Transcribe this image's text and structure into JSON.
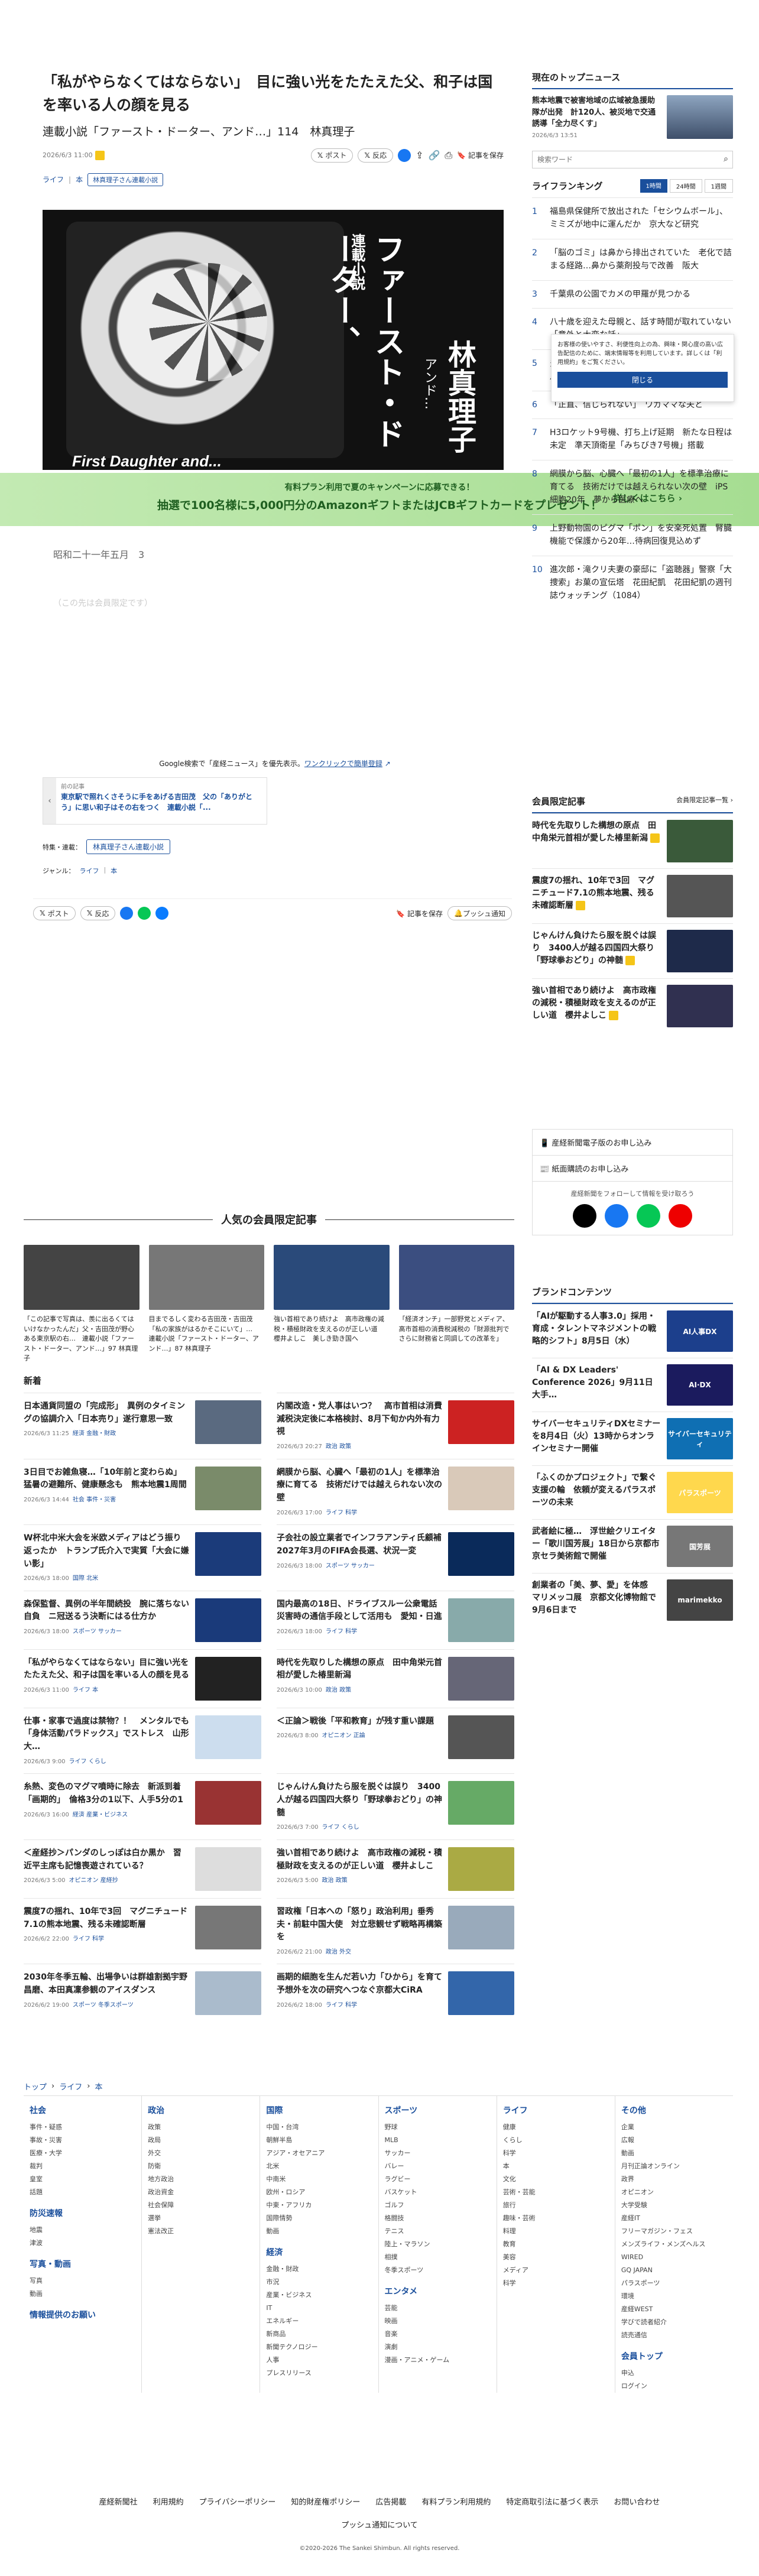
{
  "article": {
    "title": "「私がやらなくてはならない」　目に強い光をたたえた父、和子は国を率いる人の顔を見る",
    "subtitle": "連載小説「ファースト・ドーター、アンド…」114　林真理子",
    "date": "2026/6/3 11:00",
    "category_links": [
      "ライフ",
      "本"
    ],
    "series_tag": "林真理子さん連載小説",
    "share_labels": [
      "ポスト",
      "反応"
    ],
    "save_label": "記事を保存",
    "hero": {
      "series": "連載小説",
      "title_vertical": "ファースト・ドーター、",
      "title_and": "アンド…",
      "author_vertical": "林真理子",
      "english": "First Daughter and..."
    },
    "body_date": "昭和二十一年五月　3",
    "body_faded": "（この先は会員限定です）",
    "google_pref_text": "Google検索で「産経ニュース」を優先表示。",
    "google_pref_link": "ワンクリックで簡単登録",
    "prev_label": "前の記事",
    "prev_text": "東京駅で照れくさそうに手をあげる吉田茂　父の「ありがとう」に思い和子はその右をつく　連載小説「...",
    "feature_label": "特集・連載：",
    "feature_tag": "林真理子さん連載小説",
    "genre_label": "ジャンル：",
    "genre_values": [
      "ライフ",
      "本"
    ],
    "bottom_save_label": "記事を保存",
    "push_label": "プッシュ通知"
  },
  "promo": {
    "line1": "有料プラン利用で夏のキャンペーンに応募できる！",
    "line2": "抽選で100名様に5,000円分のAmazonギフトまたはJCBギフトカードをプレゼント！",
    "more": "詳しくはこちら"
  },
  "sidebar": {
    "top_news_title": "現在のトップニュース",
    "top_news_text": "熊本地震で被害地域の広域被急援助隊が出発　計120人、被災地で交通誘導「全力尽くす」",
    "top_news_date": "2026/6/3 13:51",
    "search_placeholder": "検索ワード",
    "ranking_title": "ライフランキング",
    "ranking_tabs": [
      "1時間",
      "24時間",
      "1週間"
    ],
    "ranking_items": [
      {
        "num": "1",
        "text": "福島県保健所で放出された「セシウムボール」、ミミズが地中に運んだか　京大など研究"
      },
      {
        "num": "2",
        "text": "「脳のゴミ」は鼻から排出されていた　老化で詰まる経路…鼻から薬剤投与で改善　阪大"
      },
      {
        "num": "3",
        "text": "千葉県の公園でカメの甲羅が見つかる"
      },
      {
        "num": "4",
        "text": "八十歳を迎えた母親と、話す時間が取れていない　「意外と大変な話」"
      },
      {
        "num": "5",
        "text": "多摩動物園でライオン3頭死亡、雨で影響か　7月から10頭体制　ライオン展示"
      },
      {
        "num": "6",
        "text": "「正直、信じられない」　ワガママな夫と"
      },
      {
        "num": "7",
        "text": "H3ロケット9号機、打ち上げ延期　新たな日程は未定　準天頂衛星「みちびき7号機」搭載"
      },
      {
        "num": "8",
        "text": "網膜から脳、心臓へ「最初の1人」を標準治療に育てる　技術だけでは越えられない次の壁　iPS細胞20年　夢から医療へ"
      },
      {
        "num": "9",
        "text": "上野動物園のピグマ「ポン」を安楽死処置　腎臓機能で保護から20年…待病回復見込めず"
      },
      {
        "num": "10",
        "text": "進次郎・滝クリ夫妻の豪邸に「盗聴器」警察「大捜索」お菓の宣伝塔　花田紀凱　花田紀凱の週刊誌ウォッチング（1084）"
      }
    ],
    "cookie": {
      "text": "お客様の使いやすさ、利便性向上の為、興味・関心度の高い広告配信のために、端末情報等を利用しています。詳しくは「利用規約」をご覧ください。",
      "link": "利用規約",
      "close": "閉じる"
    },
    "member_title": "会員限定記事",
    "member_more": "会員限定記事一覧",
    "member_items": [
      "時代を先取りした構想の原点　田中角栄元首相が愛した椿里新潟",
      "震度7の揺れ、10年で3回　マグニチュード7.1の熊本地震、残る未確認断層",
      "じゃんけん負けたら服を脱ぐは誤り　3400人が越る四国四大祭り「野球拳おどり」の神髄",
      "強い首相であり続けよ　高市政権の減税・積極財政を支えるのが正しい道　櫻井よしこ"
    ],
    "newsletter_label": "産経新聞電子版のお申し込み",
    "paper_label": "紙面購読のお申し込み",
    "follow_label": "産経新聞をフォローして情報を受け取ろう",
    "brand_title": "ブランドコンテンツ",
    "brand_items": [
      "「AIが駆動する人事3.0」採用・育成・タレントマネジメントの戦略的シフト」8月5日（水）",
      "「AI & DX Leaders' Conference 2026」9月11日大手…",
      "サイバーセキュリティDXセミナーを8月4日（火）13時からオンラインセミナー開催",
      "「ふくのかプロジェクト」で繋ぐ支援の輪　依頼が変えるパラスポーツの未来",
      "武者絵に極…　浮世絵クリエイター「歌川国芳展」18日から京都市京セラ美術館で開催",
      "創業者の「美、夢、愛」を体感　マリメッコ展　京都文化博物館で9月6日まで"
    ],
    "brand_thumbs": [
      "AI人事DX",
      "AI·DX",
      "サイバーセキュリティ",
      "パラスポーツ",
      "国芳展",
      "marimekko"
    ]
  },
  "popular": {
    "title": "人気の会員限定記事",
    "items": [
      {
        "text": "「この記事で写真は、羨に出るくてはいけなかったんだ」父・吉田茂が野心ある東京駅の右…　連載小説「ファースト・ドーター、アンド…」97 林真理子"
      },
      {
        "text": "目までるしく変わる吉田茂・吉田茂「私の家族がはるかそこにいて」…　連載小説「ファースト・ドーター、アンド…」87 林真理子"
      },
      {
        "text": "強い首相であり続けよ　高市政権の減税・積極財政を支えるのが正しい道　櫻井よしこ　美しき勁き国へ"
      },
      {
        "text": "「経済オンチ」一部野党とメディア、高市首相の消費税減税の「財源批判でさらに財務省と同調しての改革を」"
      }
    ]
  },
  "news": {
    "title": "新着",
    "items": [
      {
        "text": "日本通貨同盟の「完成形」　異例のタイミングの協調介入「日本売り」遂行意思一致",
        "date": "2026/6/3 11:25",
        "tags": "経済 金融・財政"
      },
      {
        "text": "内閣改造・党人事はいつ？　高市首相は消費減税決定後に本格検討、8月下旬か内外有力視",
        "date": "2026/6/3 20:27",
        "tags": "政治 政策"
      },
      {
        "text": "3日目でお雑魚寝…「10年前と変わらぬ」猛暑の避難所、健康懸念も　熊本地震1周間",
        "date": "2026/6/3 14:44",
        "tags": "社会 事件・災害"
      },
      {
        "text": "網膜から脳、心臓へ「最初の1人」を標準治療に育てる　技術だけでは越えられない次の壁",
        "date": "2026/6/3 17:00",
        "tags": "ライフ 科学"
      },
      {
        "text": "W杯北中米大会を米欧メディアはどう振り返ったか　トランプ氏介入で実質「大会に嫌い影」",
        "date": "2026/6/3 18:00",
        "tags": "国際 北米"
      },
      {
        "text": "子会社の設立業者でインフラアンティ氏顧補　2027年3月のFIFA会長選、状況一変",
        "date": "2026/6/3 18:00",
        "tags": "スポーツ サッカー"
      },
      {
        "text": "森保監督、異例の半年間続投　腕に落ちない自負　ニ冠送るう決断にはる仕方か",
        "date": "2026/6/3 18:00",
        "tags": "スポーツ サッカー"
      },
      {
        "text": "国内最高の18日、ドライブスルー公衆電話　災害時の通信手段として活用も　愛知・日進",
        "date": "2026/6/3 18:00",
        "tags": "ライフ 科学"
      },
      {
        "text": "「私がやらなくてはならない」目に強い光をたたえた父、和子は国を率いる人の顔を見る",
        "date": "2026/6/3 11:00",
        "tags": "ライフ 本"
      },
      {
        "text": "時代を先取りした構想の原点　田中角栄元首相が愛した椿里新潟",
        "date": "2026/6/3 10:00",
        "tags": "政治 政策"
      },
      {
        "text": "仕事・家事で過度は禁物？！　メンタルでも「身体活動パラドックス」でストレス　山形大…",
        "date": "2026/6/3 9:00",
        "tags": "ライフ くらし"
      },
      {
        "text": "＜正論＞戦後「平和教育」が残す重い課題",
        "date": "2026/6/3 8:00",
        "tags": "オピニオン 正論"
      },
      {
        "text": "糸熱、変色のマグマ噴時に除去　新派到着「画期的」　倫格3分の1以下、人手5分の1",
        "date": "2026/6/3 16:00",
        "tags": "経済 産業・ビジネス"
      },
      {
        "text": "じゃんけん負けたら服を脱ぐは誤り　3400人が越る四国四大祭り「野球拳おどり」の神髄",
        "date": "2026/6/3 7:00",
        "tags": "ライフ くらし"
      },
      {
        "text": "＜産経抄＞パンダのしっぽは白か黒か　習近平主席も記憶喪遊されている？",
        "date": "2026/6/3 5:00",
        "tags": "オピニオン 産経抄"
      },
      {
        "text": "強い首相であり続けよ　高市政権の減税・積極財政を支えるのが正しい道　櫻井よしこ",
        "date": "2026/6/3 5:00",
        "tags": "政治 政策"
      },
      {
        "text": "震度7の揺れ、10年で3回　マグニチュード7.1の熊本地震、残る未確認断層",
        "date": "2026/6/2 22:00",
        "tags": "ライフ 科学"
      },
      {
        "text": "習政権「日本への「怒り」政治利用」垂秀夫・前駐中国大使　対立悲観せず戦略再構築を",
        "date": "2026/6/2 21:00",
        "tags": "政治 外交"
      },
      {
        "text": "2030年冬季五輪、出場争いは群雄割拠宇野昌磨、本田真凜参観のアイスダンス",
        "date": "2026/6/2 19:00",
        "tags": "スポーツ 冬季スポーツ"
      },
      {
        "text": "画期的細胞を生んだ若い力「ひから」を育て　予想外を次の研究へつなぐ京都大CiRA",
        "date": "2026/6/2 18:00",
        "tags": "ライフ 科学"
      }
    ]
  },
  "footer": {
    "breadcrumb": [
      "トップ",
      "ライフ",
      "本"
    ],
    "columns": [
      {
        "title": "社会",
        "items": [
          "事件・疑惑",
          "事故・災害",
          "医療・大学",
          "裁判",
          "皇室",
          "話題"
        ],
        "sub": [
          {
            "title": "防災速報",
            "items": [
              "地震",
              "津波"
            ]
          },
          {
            "title": "写真・動画",
            "items": [
              "写真",
              "動画"
            ]
          },
          {
            "title": "情報提供のお願い",
            "items": []
          }
        ]
      },
      {
        "title": "政治",
        "items": [
          "政策",
          "政局",
          "外交",
          "防衛",
          "地方政治",
          "政治資金",
          "社会保障",
          "選挙",
          "憲法改正"
        ],
        "sub": []
      },
      {
        "title": "国際",
        "items": [
          "中国・台湾",
          "朝鮮半島",
          "アジア・オセアニア",
          "北米",
          "中南米",
          "欧州・ロシア",
          "中東・アフリカ",
          "国際情勢",
          "動画"
        ],
        "sub": [
          {
            "title": "経済",
            "items": [
              "金融・財政",
              "市況",
              "産業・ビジネス",
              "IT",
              "エネルギー",
              "新商品",
              "新聞テクノロジー",
              "人事",
              "プレスリリース"
            ]
          }
        ]
      },
      {
        "title": "スポーツ",
        "items": [
          "野球",
          "MLB",
          "サッカー",
          "バレー",
          "ラグビー",
          "バスケット",
          "ゴルフ",
          "格闘技",
          "テニス",
          "陸上・マラソン",
          "相撲",
          "冬季スポーツ"
        ],
        "sub": [
          {
            "title": "エンタメ",
            "items": [
              "芸能",
              "映画",
              "音楽",
              "演劇",
              "漫画・アニメ・ゲーム"
            ]
          }
        ]
      },
      {
        "title": "ライフ",
        "items": [
          "健康",
          "くらし",
          "科学",
          "本",
          "文化",
          "芸術・芸能",
          "旅行",
          "趣味・芸術",
          "料理",
          "教育",
          "美容",
          "メディア",
          "科学"
        ],
        "sub": []
      },
      {
        "title": "その他",
        "items": [
          "企業",
          "広報",
          "動画",
          "月刊正論オンライン",
          "政界",
          "オピニオン",
          "大学受験",
          "産経IT",
          "フリーマガジン・フェス",
          "メンズライフ・メンズヘルス",
          "WIRED",
          "GQ JAPAN",
          "パラスポーツ",
          "環境",
          "産経WEST",
          "学びで読者紹介",
          "読売通信"
        ],
        "sub": [
          {
            "title": "会員トップ",
            "items": [
              "申込",
              "ログイン"
            ]
          }
        ]
      }
    ],
    "links": [
      "産経新聞社",
      "利用規約",
      "プライバシーポリシー",
      "知的財産権ポリシー",
      "広告掲載",
      "有料プラン利用規約",
      "特定商取引法に基づく表示",
      "お問い合わせ"
    ],
    "push": "プッシュ通知について",
    "copyright": "©2020-2026 The Sankei Shimbun. All rights reserved."
  },
  "colors": {
    "accent": "#1a4f9c",
    "promo_green": "#b6e5a8",
    "promo_text": "#1f5f20",
    "yellow": "#f5c518"
  }
}
